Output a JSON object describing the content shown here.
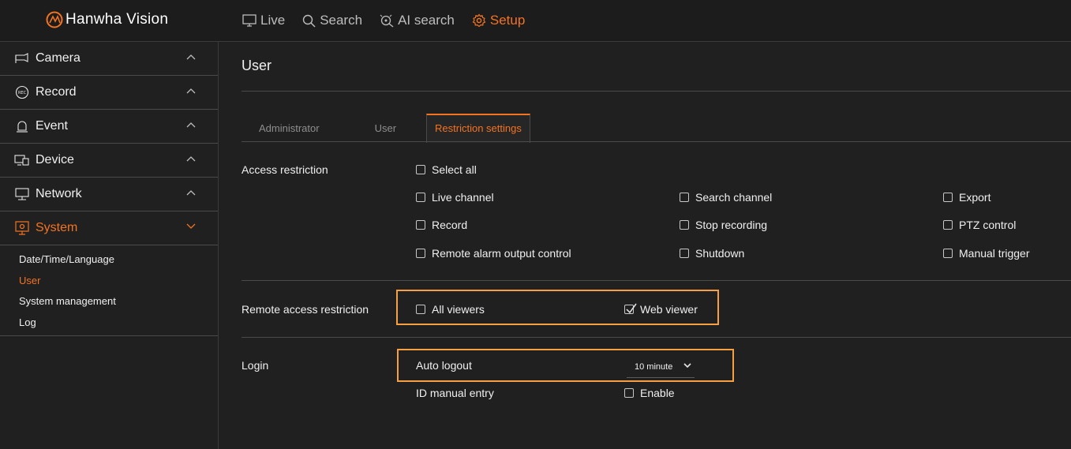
{
  "brand": {
    "name": "Hanwha Vision",
    "accent": "#f37321"
  },
  "topnav": [
    {
      "label": "Live",
      "icon": "monitor-icon"
    },
    {
      "label": "Search",
      "icon": "search-icon"
    },
    {
      "label": "AI search",
      "icon": "ai-search-icon"
    },
    {
      "label": "Setup",
      "icon": "gear-icon",
      "active": true
    }
  ],
  "sidebar": {
    "items": [
      {
        "label": "Camera",
        "icon": "camera-icon"
      },
      {
        "label": "Record",
        "icon": "rec-icon"
      },
      {
        "label": "Event",
        "icon": "bell-icon"
      },
      {
        "label": "Device",
        "icon": "device-icon"
      },
      {
        "label": "Network",
        "icon": "network-icon"
      },
      {
        "label": "System",
        "icon": "system-icon",
        "active": true
      }
    ],
    "subitems": [
      {
        "label": "Date/Time/Language"
      },
      {
        "label": "User",
        "active": true
      },
      {
        "label": "System management"
      },
      {
        "label": "Log"
      }
    ]
  },
  "page": {
    "title": "User",
    "tabs": [
      {
        "label": "Administrator"
      },
      {
        "label": "User"
      },
      {
        "label": "Restriction settings",
        "active": true
      }
    ]
  },
  "access": {
    "label": "Access restriction",
    "select_all": "Select all",
    "options": [
      {
        "label": "Live channel",
        "checked": false
      },
      {
        "label": "Search channel",
        "checked": false
      },
      {
        "label": "Export",
        "checked": false
      },
      {
        "label": "Record",
        "checked": false
      },
      {
        "label": "Stop recording",
        "checked": false
      },
      {
        "label": "PTZ control",
        "checked": false
      },
      {
        "label": "Remote alarm output control",
        "checked": false
      },
      {
        "label": "Shutdown",
        "checked": false
      },
      {
        "label": "Manual trigger",
        "checked": false
      }
    ]
  },
  "remote": {
    "label": "Remote access restriction",
    "all_viewers": {
      "label": "All viewers",
      "checked": false
    },
    "web_viewer": {
      "label": "Web viewer",
      "checked": true
    }
  },
  "login": {
    "label": "Login",
    "auto_logout_label": "Auto logout",
    "auto_logout_value": "10 minute",
    "id_manual_entry_label": "ID manual entry",
    "enable": {
      "label": "Enable",
      "checked": false
    }
  }
}
